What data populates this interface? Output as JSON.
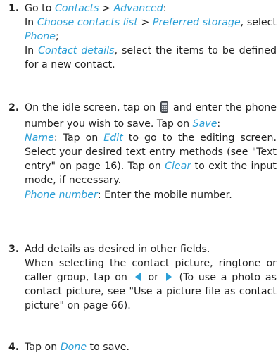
{
  "colors": {
    "ui_term": "#2b9fd6",
    "text": "#1f1f1f"
  },
  "steps": [
    {
      "num": "1.",
      "l1_a": "Go to ",
      "l1_contacts": "Contacts",
      "l1_gt": " > ",
      "l1_advanced": "Advanced",
      "l1_colon": ":",
      "l2_in": "In ",
      "l2_choose": "Choose contacts list",
      "l2_gt": " > ",
      "l2_pref": "Preferred storage",
      "l2_comma": ",",
      "l3_select": "select ",
      "l3_phone": "Phone",
      "l3_semi": ";",
      "l4_in": "In ",
      "l4_details": "Contact details",
      "l4_rest": ", select the items to be defined for a new contact."
    },
    {
      "num": "2.",
      "a_text": "On the idle screen, tap on ",
      "a_icon": "phone-keypad-icon",
      "a_rest": " and enter the phone number you wish to save. Tap on ",
      "a_save": "Save",
      "a_colon": ":",
      "b_name": "Name",
      "b_t1": ": Tap on ",
      "b_edit": "Edit",
      "b_t2": " to go to the editing screen. Select your desired text entry methods (see \"Text entry\" on page 16). Tap on ",
      "b_clear": "Clear",
      "b_t3": " to exit the input mode, if necessary.",
      "c_phone": "Phone number",
      "c_rest": ": Enter the mobile number."
    },
    {
      "num": "3.",
      "a_text": "Add details as desired in other fields.",
      "b_t1": "When selecting the contact picture, ringtone or caller group, tap on ",
      "b_left_icon": "left-arrow-icon",
      "b_or": " or ",
      "b_right_icon": "right-arrow-icon",
      "b_t2": " (To use a photo as contact picture, see \"Use a picture file as contact picture\" on page 66)."
    },
    {
      "num": "4.",
      "t1": "Tap on ",
      "done": "Done",
      "t2": " to save."
    }
  ]
}
